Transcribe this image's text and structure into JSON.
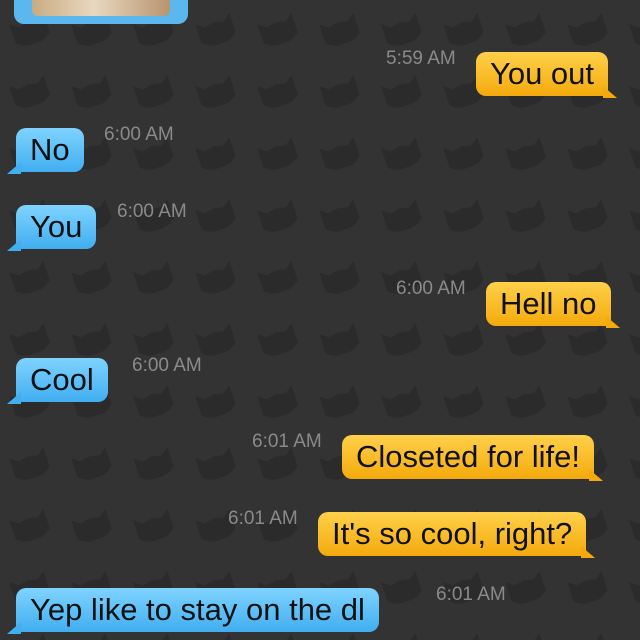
{
  "colors": {
    "background": "#333333",
    "incoming_bubble": "#41aef0",
    "outgoing_bubble": "#f4aa0c",
    "timestamp": "#8a8a8a",
    "pattern_icon": "mask-icon"
  },
  "messages": [
    {
      "direction": "out",
      "text": "You out",
      "time": "5:59 AM"
    },
    {
      "direction": "in",
      "text": "No",
      "time": "6:00 AM"
    },
    {
      "direction": "in",
      "text": "You",
      "time": "6:00 AM"
    },
    {
      "direction": "out",
      "text": "Hell no",
      "time": "6:00 AM"
    },
    {
      "direction": "in",
      "text": "Cool",
      "time": "6:00 AM"
    },
    {
      "direction": "out",
      "text": "Closeted for life!",
      "time": "6:01 AM"
    },
    {
      "direction": "out",
      "text": "It's so cool, right?",
      "time": "6:01 AM"
    },
    {
      "direction": "in",
      "text": "Yep like to stay on the dl",
      "time": "6:01 AM"
    }
  ]
}
